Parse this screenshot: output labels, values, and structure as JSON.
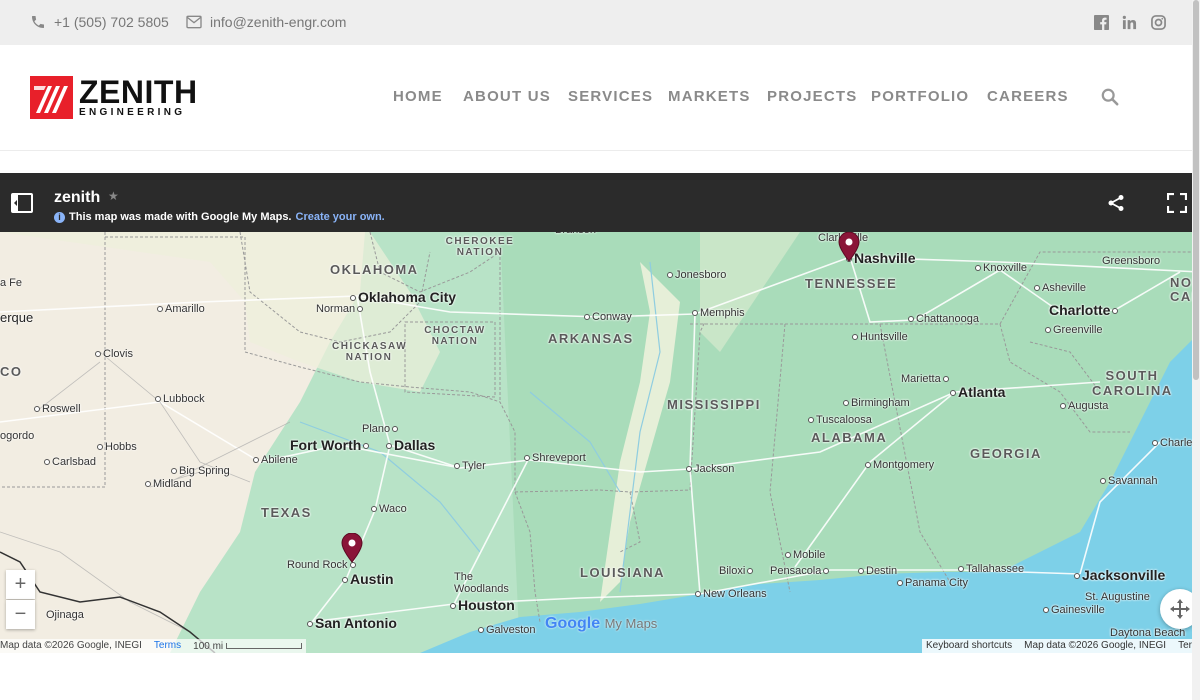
{
  "topbar": {
    "phone": "+1 (505) 702 5805",
    "email": "info@zenith-engr.com",
    "social": [
      "facebook-icon",
      "linkedin-icon",
      "instagram-icon"
    ]
  },
  "logo": {
    "name": "ZENITH",
    "sub": "ENGINEERING",
    "mark_color": "#e8202a"
  },
  "nav": {
    "items": [
      {
        "label": "HOME"
      },
      {
        "label": "ABOUT US"
      },
      {
        "label": "SERVICES"
      },
      {
        "label": "MARKETS"
      },
      {
        "label": "PROJECTS"
      },
      {
        "label": "PORTFOLIO"
      },
      {
        "label": "CAREERS"
      }
    ]
  },
  "map": {
    "title": "zenith",
    "note": "This map was made with Google My Maps.",
    "note_link": "Create your own.",
    "brand": "Google",
    "brand_suffix": "My Maps",
    "attribution_left": "Map data ©2026 Google, INEGI",
    "terms": "Terms",
    "scale": "100 mi",
    "keyboard": "Keyboard shortcuts",
    "attribution_right": "Map data ©2026 Google, INEGI",
    "terms_right": "Terms",
    "zoom_in": "+",
    "zoom_out": "−",
    "states": [
      "OKLAHOMA",
      "TEXAS",
      "ARKANSAS",
      "LOUISIANA",
      "MISSISSIPPI",
      "ALABAMA",
      "GEORGIA",
      "TENNESSEE",
      "SOUTH CAROLINA",
      "CHEROKEE NATION",
      "CHICKASAW NATION",
      "CHOCTAW NATION",
      "NOR CARO",
      "CO"
    ],
    "cities": [
      "Oklahoma City",
      "Norman",
      "Amarillo",
      "Clovis",
      "Lubbock",
      "Roswell",
      "Hobbs",
      "Carlsbad",
      "Big Spring",
      "Midland",
      "Abilene",
      "Fort Worth",
      "Dallas",
      "Plano",
      "Tyler",
      "Waco",
      "Round Rock",
      "Austin",
      "San Antonio",
      "Houston",
      "The Woodlands",
      "Galveston",
      "Ojinaga",
      "Shreveport",
      "Jonesboro",
      "Conway",
      "Memphis",
      "Jackson",
      "New Orleans",
      "Biloxi",
      "Mobile",
      "Pensacola",
      "Destin",
      "Panama City",
      "Tallahassee",
      "Montgomery",
      "Tuscaloosa",
      "Birmingham",
      "Huntsville",
      "Nashville",
      "Clarksville",
      "Knoxville",
      "Chattanooga",
      "Asheville",
      "Greensboro",
      "Charlotte",
      "Greenville",
      "Marietta",
      "Atlanta",
      "Augusta",
      "Savannah",
      "Charleston",
      "Jacksonville",
      "St. Augustine",
      "Gainesville",
      "Daytona Beach",
      "Albuquerque",
      "Santa Fe",
      "Branson",
      "Nogordo"
    ],
    "pin_color": "#8a1538"
  }
}
